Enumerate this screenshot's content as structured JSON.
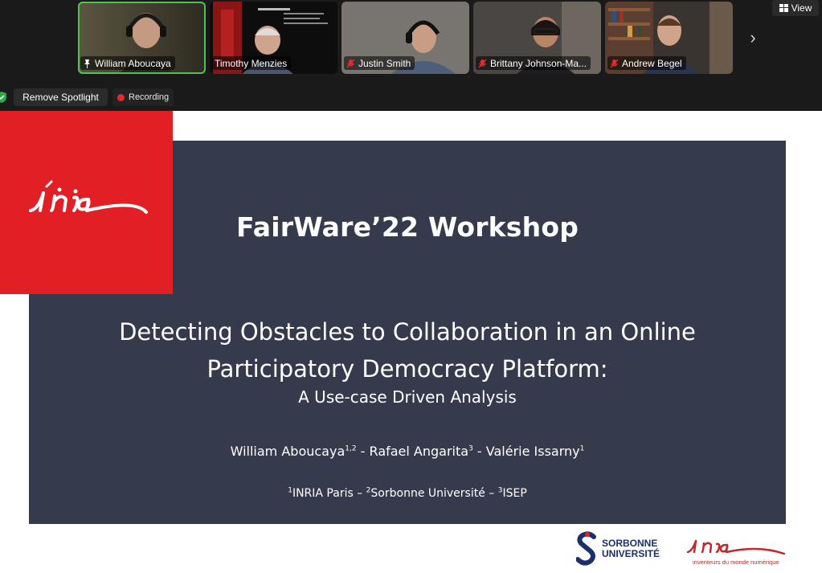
{
  "participants": [
    {
      "name": "William Aboucaya",
      "muted": false,
      "pinned": true,
      "active": true,
      "bg": "#3d3a30"
    },
    {
      "name": "Timothy Menzies",
      "muted": false,
      "pinned": false,
      "active": false,
      "bg": "#0d0d0d"
    },
    {
      "name": "Justin Smith",
      "muted": true,
      "pinned": false,
      "active": false,
      "bg": "#6d6a66"
    },
    {
      "name": "Brittany Johnson-Ma...",
      "muted": true,
      "pinned": false,
      "active": false,
      "bg": "#4a4643"
    },
    {
      "name": "Andrew Begel",
      "muted": true,
      "pinned": false,
      "active": false,
      "bg": "#3a3430"
    }
  ],
  "view_label": "View",
  "spotlight_label": "Remove Spotlight",
  "recording_label": "Recording",
  "slide": {
    "workshop": "FairWare’22 Workshop",
    "title_line1": "Detecting Obstacles to Collaboration in an Online",
    "title_line2": "Participatory Democracy Platform:",
    "subtitle": "A Use-case Driven Analysis",
    "authors": [
      {
        "name": "William Aboucaya",
        "sup": "1,2"
      },
      {
        "name": "Rafael Angarita",
        "sup": "3"
      },
      {
        "name": "Valérie Issarny",
        "sup": "1"
      }
    ],
    "affiliations": [
      {
        "sup": "1",
        "name": "INRIA Paris"
      },
      {
        "sup": "2",
        "name": "Sorbonne Université"
      },
      {
        "sup": "3",
        "name": "ISEP"
      }
    ],
    "inria_logo_text": "Inria",
    "sorbonne_line1": "SORBONNE",
    "sorbonne_line2": "UNIVERSITÉ",
    "inria_tagline": "inventeurs du monde numérique"
  },
  "colors": {
    "panel": "#353b4d",
    "inria_red": "#e11f25",
    "active_border": "#4fc24f",
    "sorbonne_blue": "#1b2f6b"
  }
}
